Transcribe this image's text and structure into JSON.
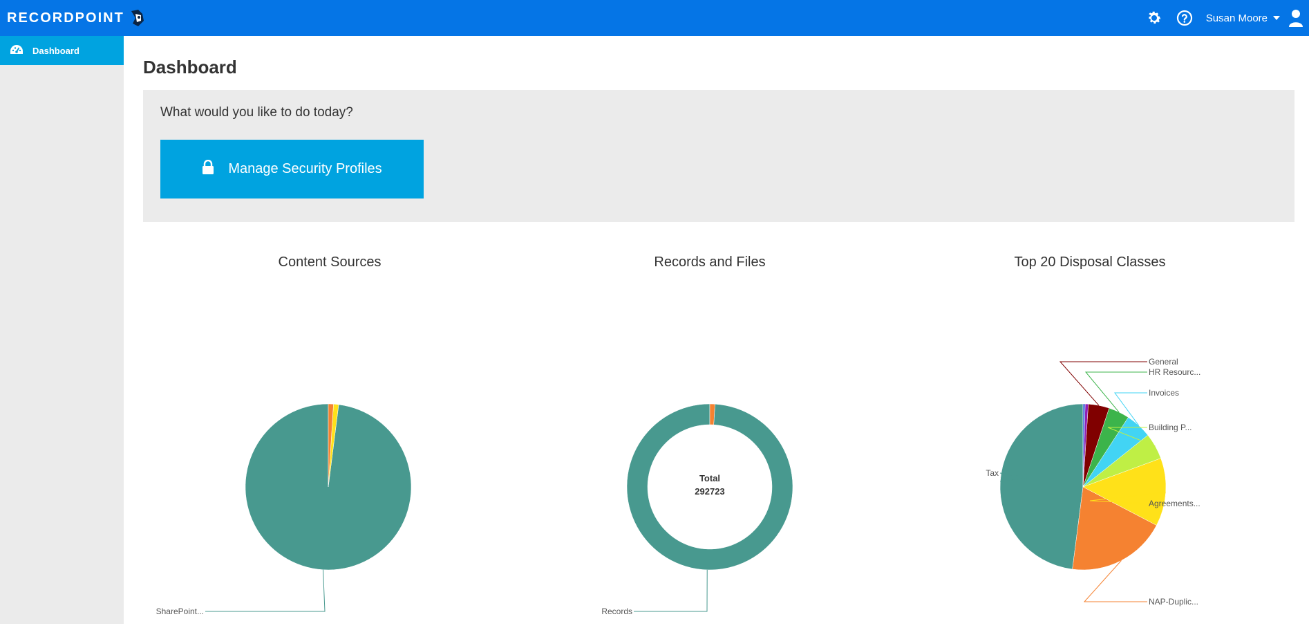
{
  "app": {
    "brand": "RECORDPOINT",
    "user_name": "Susan Moore",
    "icons": {
      "settings": "gear-icon",
      "help": "help-icon",
      "user": "user-icon"
    }
  },
  "sidebar": {
    "items": [
      {
        "label": "Dashboard",
        "icon": "dashboard-icon",
        "active": true
      }
    ]
  },
  "main": {
    "title": "Dashboard",
    "prompt": "What would you like to do today?",
    "action_button": {
      "label": "Manage Security Profiles",
      "icon": "lock-icon"
    }
  },
  "colors": {
    "topbar": "#0575e6",
    "accent": "#00a3e0",
    "teal": "#48998f"
  },
  "chart_data": [
    {
      "type": "pie",
      "title": "Content Sources",
      "slices": [
        {
          "label": "SharePoint...",
          "value": 98,
          "color": "#48998f"
        },
        {
          "label": "",
          "value": 1,
          "color": "#ffe119"
        },
        {
          "label": "",
          "value": 1,
          "color": "#f58231"
        }
      ]
    },
    {
      "type": "donut",
      "title": "Records and Files",
      "center_label": "Total",
      "center_value": "292723",
      "slices": [
        {
          "label": "Records",
          "value": 99,
          "color": "#48998f"
        },
        {
          "label": "",
          "value": 1,
          "color": "#f58231"
        }
      ]
    },
    {
      "type": "pie",
      "title": "Top 20 Disposal Classes",
      "slices": [
        {
          "label": "Tax",
          "value": 47,
          "color": "#48998f"
        },
        {
          "label": "NAP-Duplic...",
          "value": 19,
          "color": "#f58231"
        },
        {
          "label": "Agreements...",
          "value": 13,
          "color": "#ffe119"
        },
        {
          "label": "Building P...",
          "value": 5,
          "color": "#bfef45"
        },
        {
          "label": "Invoices",
          "value": 5,
          "color": "#42d4f4"
        },
        {
          "label": "HR Resourc...",
          "value": 4,
          "color": "#3cb44b"
        },
        {
          "label": "General",
          "value": 4,
          "color": "#800000"
        },
        {
          "label": "",
          "value": 0.6,
          "color": "#911eb4"
        },
        {
          "label": "",
          "value": 0.4,
          "color": "#4363d8"
        }
      ]
    }
  ]
}
